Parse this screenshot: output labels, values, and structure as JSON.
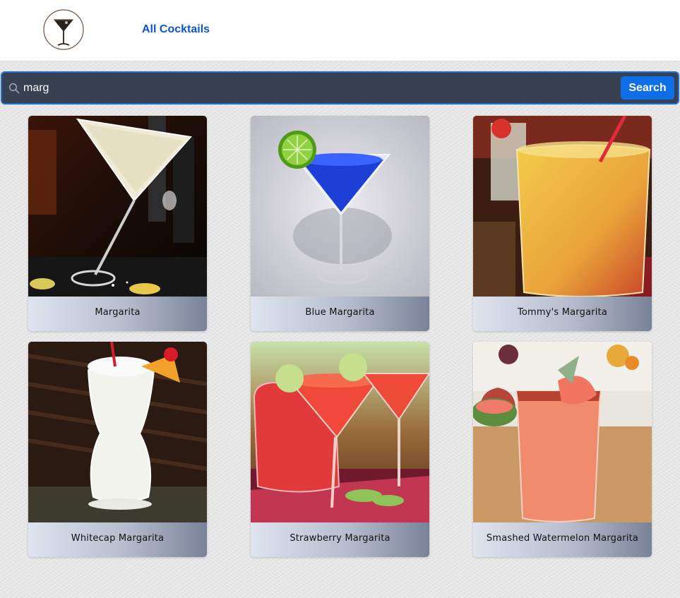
{
  "nav": {
    "logo": "martini-glass-logo",
    "link_label": "All Cocktails"
  },
  "search": {
    "icon": "search-icon",
    "value": "marg",
    "button_label": "Search"
  },
  "cocktails": [
    {
      "name": "Margarita"
    },
    {
      "name": "Blue Margarita"
    },
    {
      "name": "Tommy's Margarita"
    },
    {
      "name": "Whitecap Margarita"
    },
    {
      "name": "Strawberry Margarita"
    },
    {
      "name": "Smashed Watermelon Margarita"
    }
  ],
  "colors": {
    "link": "#0b57c9",
    "search_bg": "#374151",
    "search_border": "#1d6ee0",
    "button": "#0d6ee8"
  }
}
